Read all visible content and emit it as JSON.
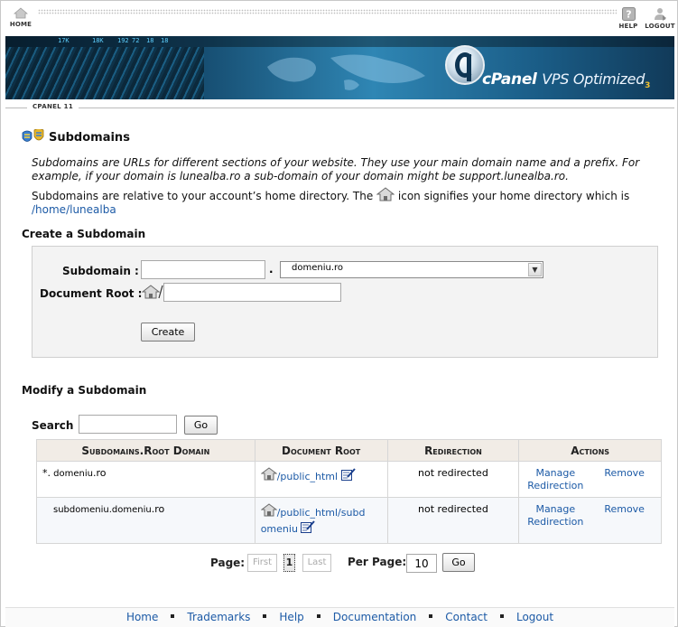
{
  "topnav": {
    "home_label": "HOME",
    "help_label": "HELP",
    "logout_label": "LOGOUT"
  },
  "banner": {
    "brand_cpanel": "cPanel",
    "brand_vps": "VPS Optimized",
    "brand_version": "3"
  },
  "theme_version": "CPANEL 11",
  "page": {
    "title": "Subdomains",
    "description_italic": "Subdomains are URLs for different sections of your website. They use your main domain name and a prefix. For example, if your domain is lunealba.ro a sub-domain of your domain might be support.lunealba.ro.",
    "description_home_pre": "Subdomains are relative to your account’s home directory. The",
    "description_home_post": "icon signifies your home directory which is",
    "home_path": "/home/lunealba"
  },
  "create": {
    "heading": "Create a Subdomain",
    "subdomain_label": "Subdomain :",
    "subdomain_value": "",
    "dot": ".",
    "domain_selected": "domeniu.ro",
    "docroot_label": "Document Root :",
    "docroot_value": "",
    "create_button": "Create"
  },
  "modify": {
    "heading": "Modify a Subdomain",
    "search_label": "Search",
    "search_value": "",
    "go_button": "Go",
    "columns": [
      "Subdomains.Root Domain",
      "Document Root",
      "Redirection",
      "Actions"
    ],
    "rows": [
      {
        "sub_prefix": "*.",
        "sub_domain": " domeniu",
        "sub_tld": ".ro",
        "docroot": "/public_html",
        "docroot_cont": "",
        "redirection": "not redirected",
        "manage": "Manage Redirection",
        "remove": "Remove"
      },
      {
        "sub_prefix": "",
        "sub_domain": "subdomeniu.domeniu",
        "sub_tld": ".ro",
        "docroot": "/public_html/subd",
        "docroot_cont": "omeniu",
        "redirection": "not redirected",
        "manage": "Manage Redirection",
        "remove": "Remove"
      }
    ]
  },
  "pager": {
    "page_label": "Page:",
    "first": "First",
    "current": "1",
    "last": "Last",
    "per_page_label": "Per Page:",
    "per_page_value": "10",
    "go": "Go"
  },
  "footer": {
    "links": [
      "Home",
      "Trademarks",
      "Help",
      "Documentation",
      "Contact",
      "Logout"
    ]
  }
}
